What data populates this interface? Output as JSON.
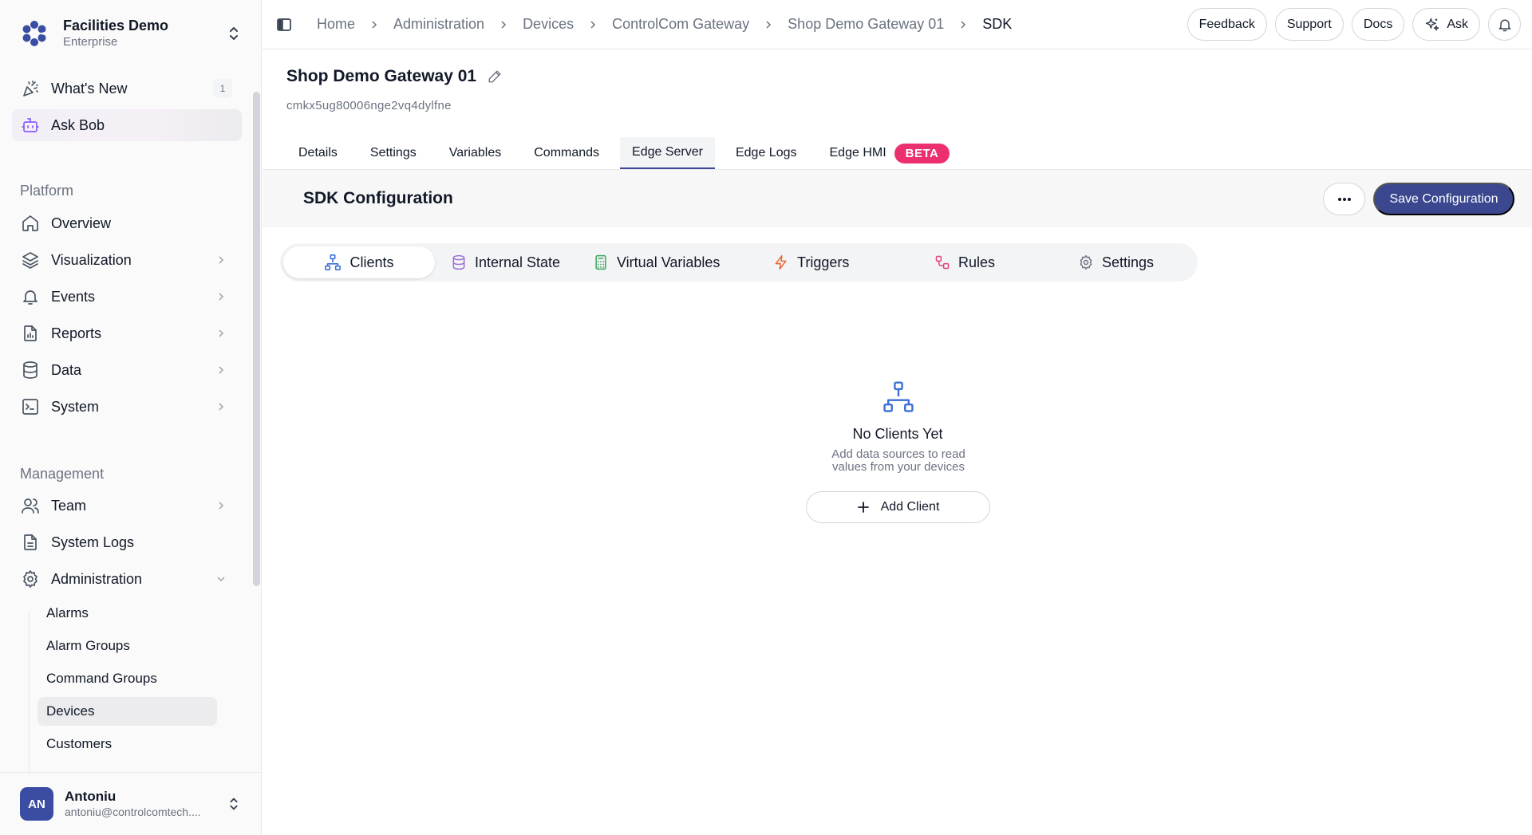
{
  "org": {
    "name": "Facilities Demo",
    "plan": "Enterprise"
  },
  "sidebar": {
    "top_items": [
      {
        "label": "What's New",
        "badge": "1",
        "icon": "party-popper-icon"
      },
      {
        "label": "Ask Bob",
        "icon": "bot-icon"
      }
    ],
    "platform_label": "Platform",
    "platform_items": [
      {
        "label": "Overview",
        "icon": "home-icon"
      },
      {
        "label": "Visualization",
        "icon": "layers-icon"
      },
      {
        "label": "Events",
        "icon": "bell-icon"
      },
      {
        "label": "Reports",
        "icon": "report-icon"
      },
      {
        "label": "Data",
        "icon": "database-icon"
      },
      {
        "label": "System",
        "icon": "terminal-icon"
      }
    ],
    "management_label": "Management",
    "management_items": [
      {
        "label": "Team",
        "icon": "users-icon"
      },
      {
        "label": "System Logs",
        "icon": "file-text-icon"
      },
      {
        "label": "Administration",
        "icon": "gear-icon"
      }
    ],
    "admin_subitems": [
      "Alarms",
      "Alarm Groups",
      "Command Groups",
      "Devices",
      "Customers"
    ],
    "active_subitem": "Devices"
  },
  "user": {
    "initials": "AN",
    "name": "Antoniu",
    "email": "antoniu@controlcomtech...."
  },
  "breadcrumbs": [
    "Home",
    "Administration",
    "Devices",
    "ControlCom Gateway",
    "Shop Demo Gateway 01",
    "SDK"
  ],
  "topbar": {
    "feedback": "Feedback",
    "support": "Support",
    "docs": "Docs",
    "ask": "Ask"
  },
  "page": {
    "title": "Shop Demo Gateway 01",
    "id": "cmkx5ug80006nge2vq4dylfne"
  },
  "tabs": [
    "Details",
    "Settings",
    "Variables",
    "Commands",
    "Edge Server",
    "Edge Logs",
    "Edge HMI"
  ],
  "active_tab": "Edge Server",
  "beta_label": "BETA",
  "sdk": {
    "title": "SDK Configuration",
    "more": "···",
    "save": "Save Configuration"
  },
  "subtabs": [
    {
      "label": "Clients",
      "icon": "network-icon",
      "color": "#3b6fd6"
    },
    {
      "label": "Internal State",
      "icon": "database-icon",
      "color": "#9b6fd6"
    },
    {
      "label": "Virtual Variables",
      "icon": "calculator-icon",
      "color": "#3aa65b"
    },
    {
      "label": "Triggers",
      "icon": "zap-icon",
      "color": "#f0642c"
    },
    {
      "label": "Rules",
      "icon": "workflow-icon",
      "color": "#e0467a"
    },
    {
      "label": "Settings",
      "icon": "gear-icon",
      "color": "#6b7280"
    }
  ],
  "active_subtab": "Clients",
  "empty": {
    "title": "No Clients Yet",
    "desc": "Add data sources to read values from your devices",
    "button": "Add Client",
    "color": "#3b6fd6"
  }
}
